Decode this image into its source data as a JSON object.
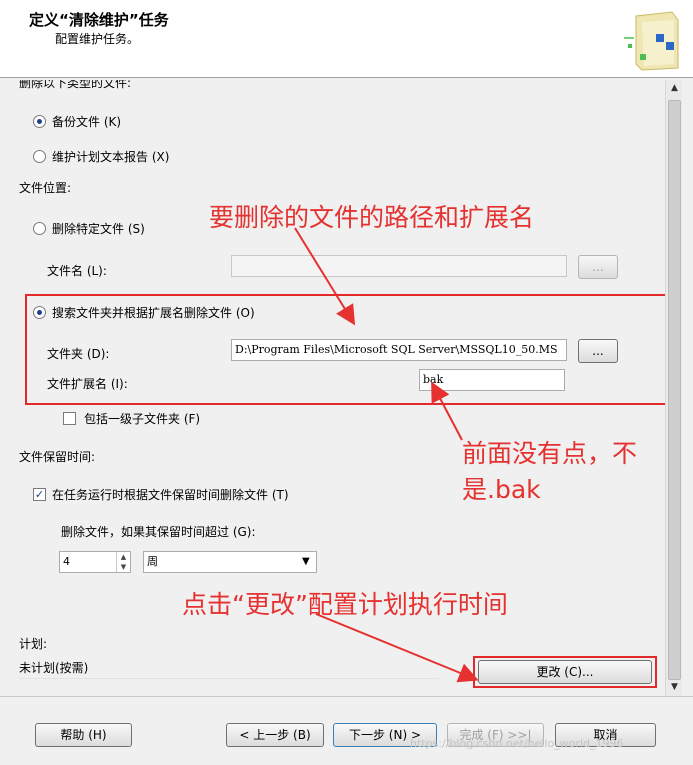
{
  "header": {
    "title": "定义“清除维护”任务",
    "subtitle": "配置维护任务。"
  },
  "options": {
    "delete_type_label": "删除以下类型的文件:",
    "backup_files": "备份文件 (K)",
    "report_files": "维护计划文本报告 (X)",
    "file_location_label": "文件位置:",
    "delete_specific_file": "删除特定文件 (S)",
    "file_name_label": "文件名 (L):",
    "file_name_value": "",
    "browse": "...",
    "search_folder": "搜索文件夹并根据扩展名删除文件 (O)",
    "folder_label": "文件夹 (D):",
    "folder_value": "D:\\Program Files\\Microsoft SQL Server\\MSSQL10_50.MS",
    "extension_label": "文件扩展名 (I):",
    "extension_value": "bak",
    "include_subfolders": "包括一级子文件夹 (F)",
    "retention_label": "文件保留时间:",
    "delete_by_age": "在任务运行时根据文件保留时间删除文件 (T)",
    "older_than_label": "删除文件，如果其保留时间超过 (G):",
    "age_value": "4",
    "age_unit": "周",
    "schedule_label": "计划:",
    "schedule_value": "未计划(按需)",
    "change_button": "更改 (C)..."
  },
  "annotations": {
    "path_note": "要删除的文件的路径和扩展名",
    "ext_note_line1": "前面没有点，不",
    "ext_note_line2": "是.bak",
    "change_note": "点击“更改”配置计划执行时间"
  },
  "footer": {
    "help": "帮助 (H)",
    "back": "< 上一步 (B)",
    "next": "下一步 (N) >",
    "finish": "完成 (F) >>|",
    "cancel": "取消",
    "watermark": "https://blog.csdn.net/hello_world_1996"
  },
  "colors": {
    "annotation_red": "#e5312f",
    "radio_selected": "#1f3f8f"
  }
}
